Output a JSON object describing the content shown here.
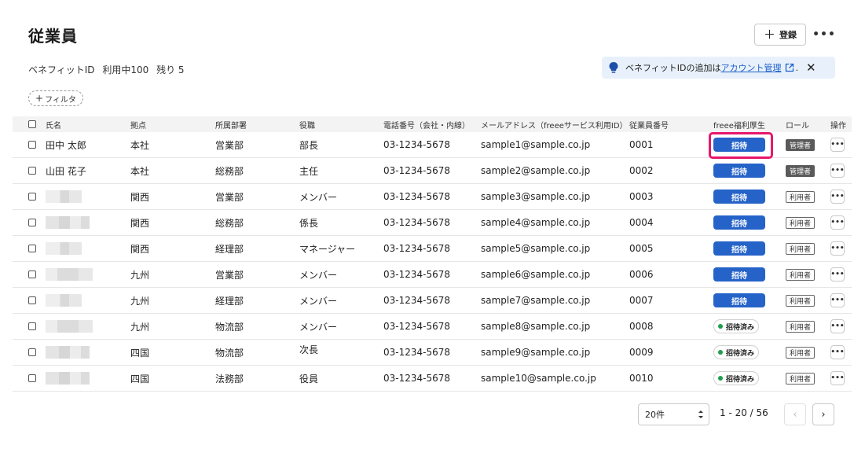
{
  "page": {
    "title": "従業員"
  },
  "header": {
    "register_label": "登録",
    "more_label": "•••"
  },
  "benefit": {
    "label": "ベネフィットID",
    "in_use": "利用中100",
    "remaining": "残り 5"
  },
  "notice": {
    "text": "ベネフィットIDの追加は",
    "link": "アカウント管理",
    "suffix": ".",
    "icon": "lightbulb-icon",
    "close_label": "✕"
  },
  "filter": {
    "label": "フィルタ"
  },
  "table": {
    "headers": [
      "氏名",
      "拠点",
      "所属部署",
      "役職",
      "電話番号（会社・内線）",
      "メールアドレス（freeeサービス利用ID）",
      "従業員番号",
      "freee福利厚生",
      "ロール",
      "操作"
    ],
    "rows": [
      {
        "name": "田中 太郎",
        "blurred": false,
        "location": "本社",
        "department": "営業部",
        "position": "部長",
        "phone": "03-1234-5678",
        "email": "sample1@sample.co.jp",
        "employee_no": "0001",
        "benefit_status": "招待",
        "role": "管理者"
      },
      {
        "name": "山田 花子",
        "blurred": false,
        "location": "本社",
        "department": "総務部",
        "position": "主任",
        "phone": "03-1234-5678",
        "email": "sample2@sample.co.jp",
        "employee_no": "0002",
        "benefit_status": "招待",
        "role": "管理者"
      },
      {
        "name": "",
        "blurred": true,
        "location": "関西",
        "department": "営業部",
        "position": "メンバー",
        "phone": "03-1234-5678",
        "email": "sample3@sample.co.jp",
        "employee_no": "0003",
        "benefit_status": "招待",
        "role": "利用者"
      },
      {
        "name": "",
        "blurred": true,
        "location": "関西",
        "department": "総務部",
        "position": "係長",
        "phone": "03-1234-5678",
        "email": "sample4@sample.co.jp",
        "employee_no": "0004",
        "benefit_status": "招待",
        "role": "利用者"
      },
      {
        "name": "",
        "blurred": true,
        "location": "関西",
        "department": "経理部",
        "position": "マネージャー",
        "phone": "03-1234-5678",
        "email": "sample5@sample.co.jp",
        "employee_no": "0005",
        "benefit_status": "招待",
        "role": "利用者"
      },
      {
        "name": "",
        "blurred": true,
        "location": "九州",
        "department": "営業部",
        "position": "メンバー",
        "phone": "03-1234-5678",
        "email": "sample6@sample.co.jp",
        "employee_no": "0006",
        "benefit_status": "招待",
        "role": "利用者"
      },
      {
        "name": "",
        "blurred": true,
        "location": "九州",
        "department": "経理部",
        "position": "メンバー",
        "phone": "03-1234-5678",
        "email": "sample7@sample.co.jp",
        "employee_no": "0007",
        "benefit_status": "招待",
        "role": "利用者"
      },
      {
        "name": "",
        "blurred": true,
        "location": "九州",
        "department": "物流部",
        "position": "メンバー",
        "phone": "03-1234-5678",
        "email": "sample8@sample.co.jp",
        "employee_no": "0008",
        "benefit_status": "招待済み",
        "role": "利用者"
      },
      {
        "name": "",
        "blurred": true,
        "location": "四国",
        "department": "物流部",
        "position": "次長",
        "phone": "03-1234-5678",
        "email": "sample9@sample.co.jp",
        "employee_no": "0009",
        "benefit_status": "招待済み",
        "role": "利用者"
      },
      {
        "name": "",
        "blurred": true,
        "location": "四国",
        "department": "法務部",
        "position": "役員",
        "phone": "03-1234-5678",
        "email": "sample10@sample.co.jp",
        "employee_no": "0010",
        "benefit_status": "招待済み",
        "role": "利用者"
      }
    ],
    "op_label": "•••"
  },
  "pagination": {
    "per_page": "20件",
    "range": "1 - 20 / 56",
    "prev_icon": "chevron-left-icon",
    "next_icon": "chevron-right-icon"
  },
  "colors": {
    "primary": "#2563c9",
    "highlight": "#e8176b",
    "invited_dot": "#1f9d4d",
    "admin_badge": "#5a5a5a",
    "notice_bg": "#e8f1fb"
  }
}
